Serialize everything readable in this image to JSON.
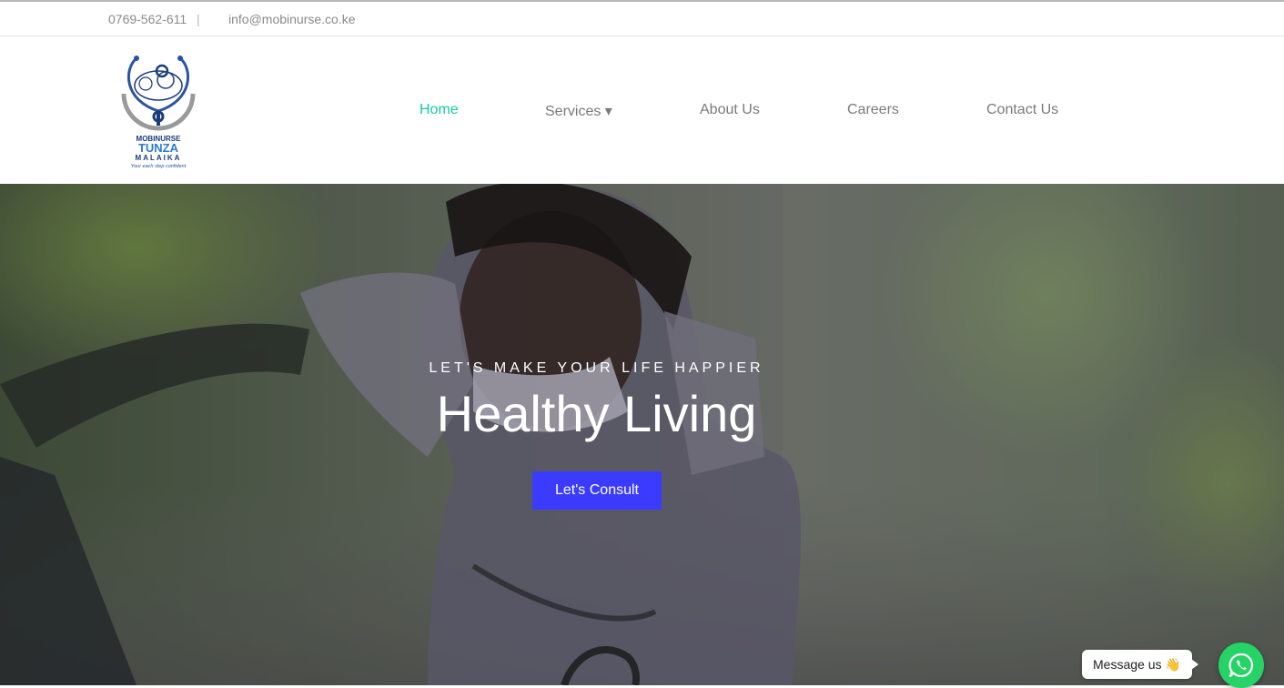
{
  "topbar": {
    "phone": "0769-562-611",
    "separator": "|",
    "email": "info@mobinurse.co.ke"
  },
  "logo": {
    "brand_line1": "MOBINURSE",
    "brand_line2": "TUNZA",
    "brand_line3": "MALAIKA",
    "slogan": "Your each step confident"
  },
  "nav": {
    "items": [
      {
        "label": "Home",
        "active": true
      },
      {
        "label": "Services ▾",
        "active": false
      },
      {
        "label": "About Us",
        "active": false
      },
      {
        "label": "Careers",
        "active": false
      },
      {
        "label": "Contact Us",
        "active": false
      }
    ]
  },
  "hero": {
    "tagline": "LET'S MAKE YOUR LIFE HAPPIER",
    "title": "Healthy Living",
    "cta_label": "Let's Consult"
  },
  "chat": {
    "bubble_text": "Message us 👋",
    "icon": "whatsapp-icon"
  },
  "colors": {
    "accent": "#19c9a0",
    "cta": "#3b3bff",
    "whatsapp": "#25d366",
    "nav_text": "#7a7a7a"
  }
}
